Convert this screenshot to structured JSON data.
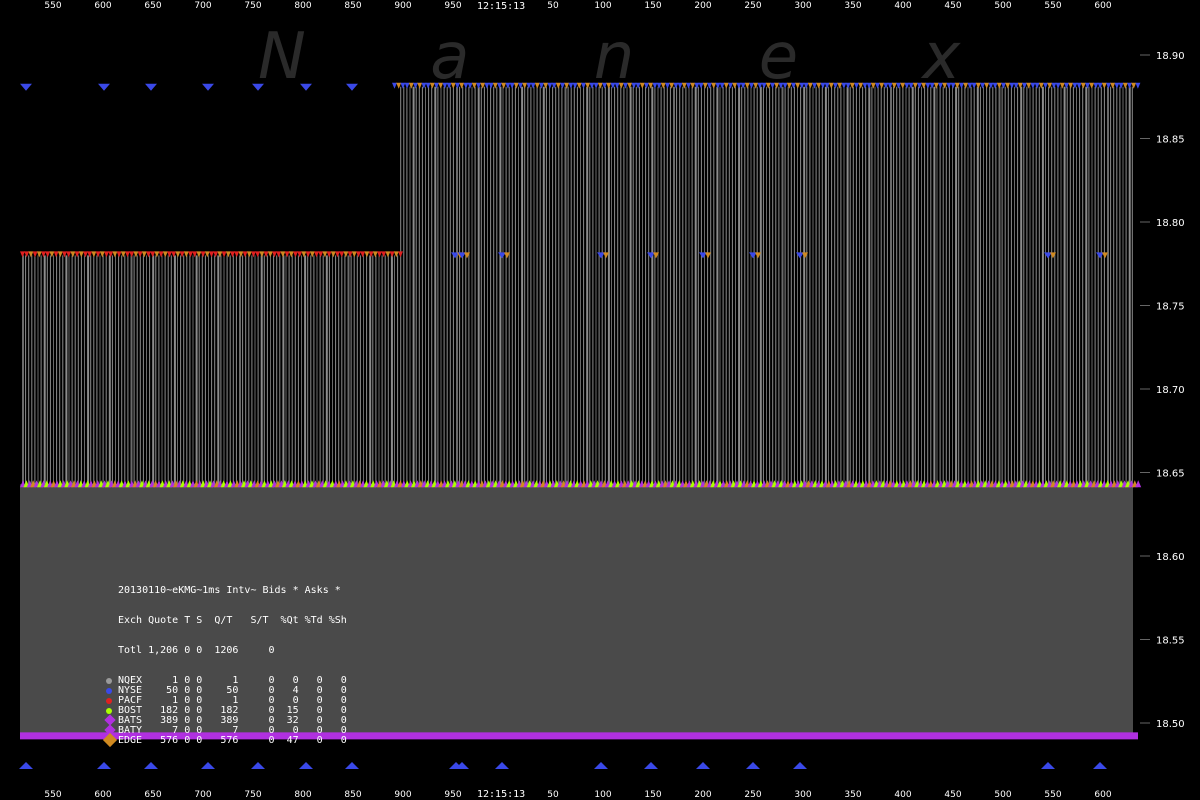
{
  "watermark": "N a n e x",
  "colors": {
    "background": "#000000",
    "plot_gray": "#4a4a4a",
    "quote_line": "#8c8c8c",
    "nyse_blue": "#3a49e8",
    "pacf_red": "#e02020",
    "bost_lime": "#aaff00",
    "bats_purple": "#b030e0",
    "edge_orange": "#d08a20",
    "axis_text": "#ffffff"
  },
  "chart_data": {
    "type": "quote_spread",
    "top_time_label": "12:15:13",
    "bottom_time_label": "12:15:13",
    "x_ticks_top": [
      "550",
      "600",
      "650",
      "700",
      "750",
      "800",
      "850",
      "900",
      "950",
      "50",
      "100",
      "150",
      "200",
      "250",
      "300",
      "350",
      "400",
      "450",
      "500",
      "550",
      "600"
    ],
    "x_ticks_bottom": [
      "550",
      "600",
      "650",
      "700",
      "750",
      "800",
      "850",
      "900",
      "950",
      "50",
      "100",
      "150",
      "200",
      "250",
      "300",
      "350",
      "400",
      "450",
      "500",
      "550",
      "600"
    ],
    "y_ticks": [
      "18.90",
      "18.85",
      "18.80",
      "18.75",
      "18.70",
      "18.65",
      "18.60",
      "18.55",
      "18.50"
    ],
    "ylim": [
      18.49,
      18.92
    ],
    "series": [
      {
        "name": "NYSE",
        "role": "ask",
        "segments": [
          {
            "from": "start",
            "to": "900",
            "price": 18.88
          }
        ]
      },
      {
        "name": "PACF",
        "role": "ask",
        "segments": [
          {
            "from": "start",
            "to": "900",
            "price": 18.78
          }
        ]
      },
      {
        "name": "NYSE",
        "role": "ask",
        "segments": [
          {
            "from": "900",
            "to": "end",
            "price": 18.88
          }
        ]
      },
      {
        "name": "BOST",
        "role": "bid",
        "segments": [
          {
            "from": "start",
            "to": "end",
            "price": 18.64
          }
        ]
      },
      {
        "name": "BATS",
        "role": "bid",
        "segments": [
          {
            "from": "start",
            "to": "end",
            "price": 18.49
          }
        ]
      }
    ]
  },
  "stats": {
    "header1": "20130110~eKMG~1ms Intv~ Bids * Asks *",
    "header2": "Exch Quote T S  Q/T   S/T  %Qt %Td %Sh",
    "total": "Totl 1,206 0 0  1206     0",
    "rows": [
      {
        "text": "NQEX     1 0 0     1     0   0   0   0",
        "color": "#9a9a9a",
        "shape": "dot"
      },
      {
        "text": "NYSE    50 0 0    50     0   4   0   0",
        "color": "#3a49e8",
        "shape": "dot"
      },
      {
        "text": "PACF     1 0 0     1     0   0   0   0",
        "color": "#e02020",
        "shape": "dot"
      },
      {
        "text": "BOST   182 0 0   182     0  15   0   0",
        "color": "#aaff00",
        "shape": "dot"
      },
      {
        "text": "BATS   389 0 0   389     0  32   0   0",
        "color": "#b030e0",
        "shape": "diamond"
      },
      {
        "text": "BATY     7 0 0     7     0   0   0   0",
        "color": "#b030e0",
        "shape": "diamond"
      },
      {
        "text": "EDGE   576 0 0   576     0  47   0   0",
        "color": "#d08a20",
        "shape": "diamond"
      }
    ]
  }
}
